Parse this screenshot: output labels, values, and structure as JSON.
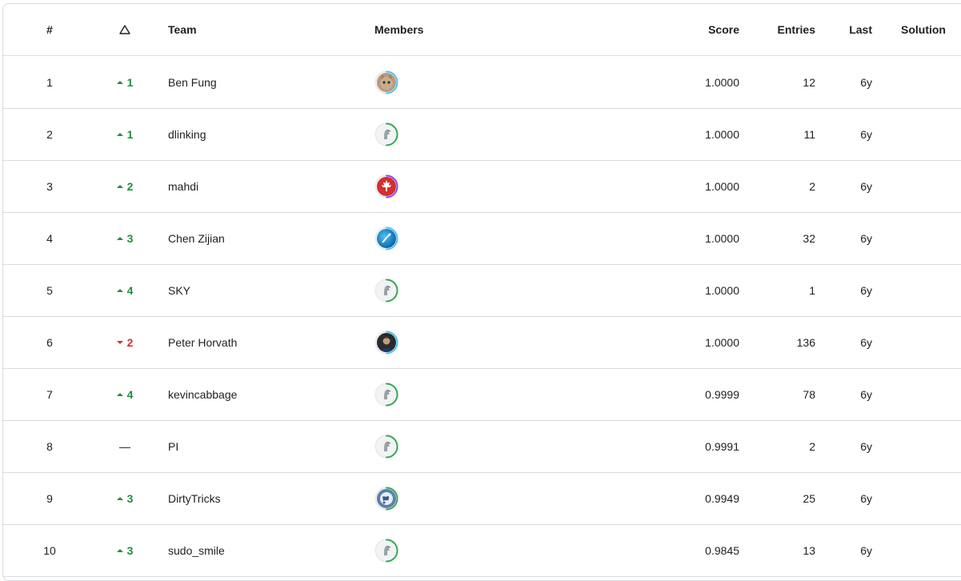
{
  "header": {
    "rank": "#",
    "team": "Team",
    "members": "Members",
    "score": "Score",
    "entries": "Entries",
    "last": "Last",
    "solution": "Solution"
  },
  "rows": [
    {
      "rank": "1",
      "delta": {
        "dir": "up",
        "value": "1"
      },
      "team": "Ben Fung",
      "avatar": "cat-avatar",
      "ring": "#4fc3f7",
      "score": "1.0000",
      "entries": "12",
      "last": "6y"
    },
    {
      "rank": "2",
      "delta": {
        "dir": "up",
        "value": "1"
      },
      "team": "dlinking",
      "avatar": "default-avatar",
      "ring": "#34a853",
      "score": "1.0000",
      "entries": "11",
      "last": "6y"
    },
    {
      "rank": "3",
      "delta": {
        "dir": "up",
        "value": "2"
      },
      "team": "mahdi",
      "avatar": "maple-leaf-avatar",
      "ring": "#8e44ef",
      "score": "1.0000",
      "entries": "2",
      "last": "6y"
    },
    {
      "rank": "4",
      "delta": {
        "dir": "up",
        "value": "3"
      },
      "team": "Chen Zijian",
      "avatar": "blue-sport-avatar",
      "ring": "#4fc3f7",
      "score": "1.0000",
      "entries": "32",
      "last": "6y"
    },
    {
      "rank": "5",
      "delta": {
        "dir": "up",
        "value": "4"
      },
      "team": "SKY",
      "avatar": "default-avatar",
      "ring": "#34a853",
      "score": "1.0000",
      "entries": "1",
      "last": "6y"
    },
    {
      "rank": "6",
      "delta": {
        "dir": "down",
        "value": "2"
      },
      "team": "Peter Horvath",
      "avatar": "person-avatar",
      "ring": "#4fc3f7",
      "score": "1.0000",
      "entries": "136",
      "last": "6y"
    },
    {
      "rank": "7",
      "delta": {
        "dir": "up",
        "value": "4"
      },
      "team": "kevincabbage",
      "avatar": "default-avatar",
      "ring": "#34a853",
      "score": "0.9999",
      "entries": "78",
      "last": "6y"
    },
    {
      "rank": "8",
      "delta": {
        "dir": "flat",
        "value": "—"
      },
      "team": "PI",
      "avatar": "default-avatar",
      "ring": "#34a853",
      "score": "0.9991",
      "entries": "2",
      "last": "6y"
    },
    {
      "rank": "9",
      "delta": {
        "dir": "up",
        "value": "3"
      },
      "team": "DirtyTricks",
      "avatar": "earth-avatar",
      "ring": "#34a853",
      "score": "0.9949",
      "entries": "25",
      "last": "6y"
    },
    {
      "rank": "10",
      "delta": {
        "dir": "up",
        "value": "3"
      },
      "team": "sudo_smile",
      "avatar": "default-avatar",
      "ring": "#34a853",
      "score": "0.9845",
      "entries": "13",
      "last": "6y"
    }
  ]
}
